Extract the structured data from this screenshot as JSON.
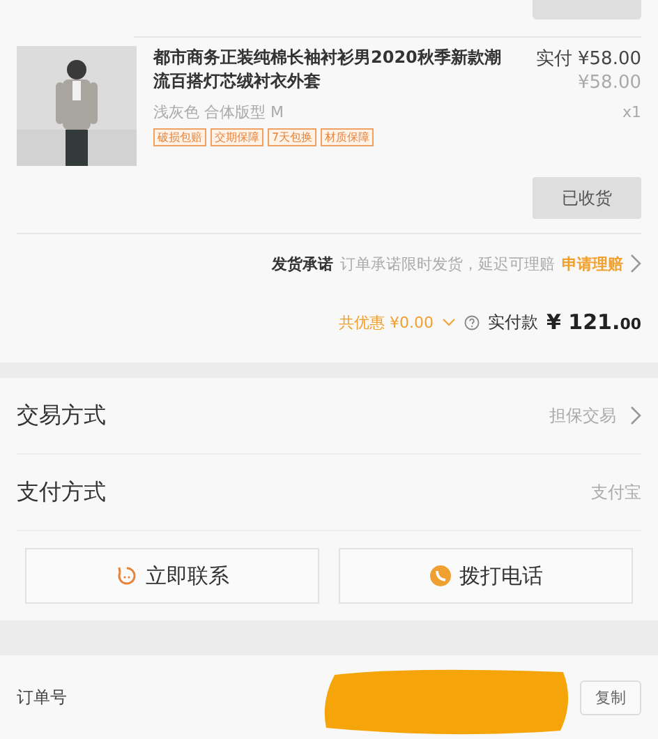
{
  "product": {
    "title": "都市商务正装纯棉长袖衬衫男2020秋季新款潮流百搭灯芯绒衬衣外套",
    "paid": "实付 ¥58.00",
    "price": "¥58.00",
    "variant": "浅灰色 合体版型 M",
    "quantity": "x1",
    "tags": [
      "破损包赔",
      "交期保障",
      "7天包换",
      "材质保障"
    ],
    "status_button": "已收货"
  },
  "promise": {
    "label": "发货承诺",
    "text": "订单承诺限时发货，延迟可理赔",
    "link": "申请理赔"
  },
  "total": {
    "discount": "共优惠 ¥0.00",
    "label": "实付款",
    "amount": "¥ 121.",
    "cents": "00"
  },
  "info_rows": [
    {
      "label": "交易方式",
      "value": "担保交易",
      "arrow": true
    },
    {
      "label": "支付方式",
      "value": "支付宝",
      "arrow": false
    }
  ],
  "actions": [
    {
      "kind": "chat",
      "label": "立即联系"
    },
    {
      "kind": "phone",
      "label": "拨打电话"
    }
  ],
  "order": {
    "label": "订单号",
    "copy": "复制"
  }
}
